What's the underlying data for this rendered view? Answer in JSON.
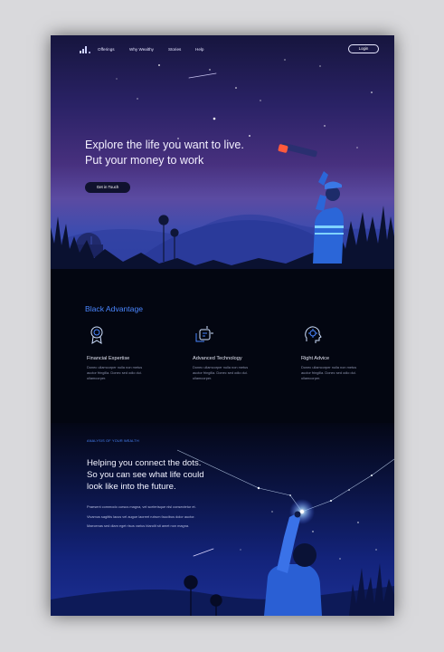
{
  "nav": {
    "links": [
      "Offerings",
      "Why Wealthy",
      "Stories",
      "Help"
    ],
    "login_label": "Login"
  },
  "hero": {
    "headline_lines": [
      "Explore the life you want to live.",
      "Put your money to work"
    ],
    "cta_label": "Get in Touch"
  },
  "advantage": {
    "title": "Black Advantage",
    "features": [
      {
        "icon": "award-ribbon-icon",
        "title": "Financial Expertise",
        "body": "Donec ullamcorper nulla non metus auctor fringilla. Donec sed odio dui. ullamcorper."
      },
      {
        "icon": "technology-cube-icon",
        "title": "Advanced Technology",
        "body": "Donec ullamcorper nulla non metus auctor fringilla. Donec sed odio dui. ullamcorper."
      },
      {
        "icon": "advisor-head-icon",
        "title": "Right Advice",
        "body": "Donec ullamcorper nulla non metus auctor fringilla. Donec sed odio dui. ullamcorper."
      }
    ]
  },
  "analysis": {
    "eyebrow": "ANALYSIS OF YOUR WEALTH",
    "headline_lines": [
      "Helping you connect the dots.",
      "So you can see what life could",
      "look like into the future."
    ],
    "paragraphs": [
      "Praesent commodo cursus magna, vel scelerisque nisl consectetur et.",
      "Vivamus sagittis lacus vel augue laoreet rutrum faucibus dolor auctor.",
      "Maecenas sed diam eget risus varius blandit sit amet non magna."
    ]
  },
  "colors": {
    "accent": "#4a86ff",
    "page_background": "#d9d9dc",
    "dark_section": "#030611"
  }
}
